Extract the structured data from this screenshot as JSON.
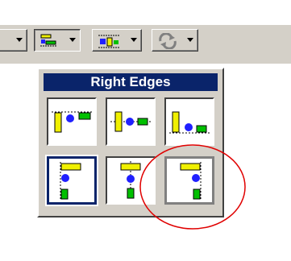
{
  "palette": {
    "title": "Right Edges"
  },
  "toolbar": {
    "buttons": [
      {
        "name": "distribute-objects-button",
        "icon": "distribute-icon",
        "dropdown": true
      },
      {
        "name": "align-objects-button",
        "icon": "align-icon",
        "dropdown": true
      },
      {
        "name": "distribute-objects-button-2",
        "icon": "distribute-horizontal-icon",
        "dropdown": true
      },
      {
        "name": "reorder-button",
        "icon": "reorder-icon",
        "dropdown": true
      }
    ]
  },
  "colors": {
    "title_bg": "#0a246a",
    "yellow": "#f0f000",
    "blue": "#2020ff",
    "green": "#00c000",
    "annotation": "#e00000"
  },
  "options": [
    {
      "name": "top-edges",
      "icon": "align-top-edges-icon"
    },
    {
      "name": "vertical-centers",
      "icon": "align-vertical-centers-icon"
    },
    {
      "name": "bottom-edges",
      "icon": "align-bottom-edges-icon"
    },
    {
      "name": "left-edges",
      "icon": "align-left-edges-icon",
      "selected": true
    },
    {
      "name": "horizontal-centers",
      "icon": "align-horizontal-centers-icon"
    },
    {
      "name": "right-edges",
      "icon": "align-right-edges-icon",
      "highlighted": true
    }
  ]
}
